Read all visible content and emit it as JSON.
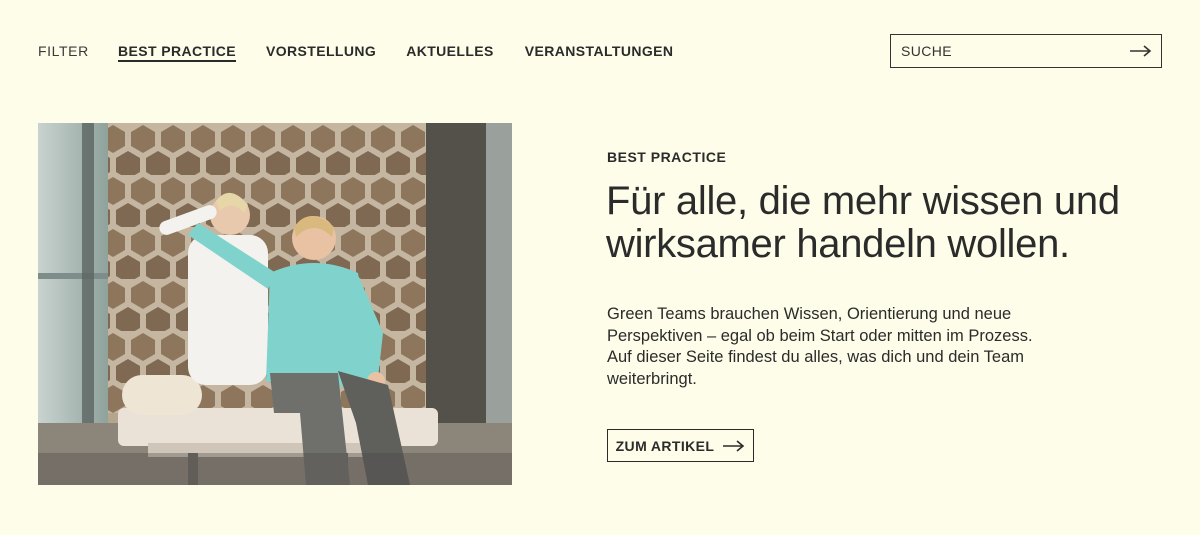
{
  "nav": {
    "filter_label": "FILTER",
    "links": [
      {
        "label": "BEST PRACTICE",
        "active": true
      },
      {
        "label": "VORSTELLUNG"
      },
      {
        "label": "AKTUELLES"
      },
      {
        "label": "VERANSTALTUNGEN"
      }
    ],
    "search": {
      "placeholder": "SUCHE",
      "value": "",
      "icon": "arrow-right-icon"
    }
  },
  "hero": {
    "image_icon": "photo"
  },
  "article": {
    "category": "BEST PRACTICE",
    "headline": "Für alle, die mehr wissen und wirksamer handeln wollen.",
    "body_lines": [
      "Green Teams brauchen Wissen, Orientierung und neue",
      "Perspektiven – egal ob beim Start oder mitten im Prozess.",
      "Auf dieser Seite findest du alles, was dich und dein Team",
      "weiterbringt."
    ],
    "cta_label": "ZUM ARTIKEL",
    "cta_icon": "arrow-right-icon"
  },
  "colors": {
    "background": "#fefde9",
    "text": "#2b2b2b",
    "shirt": "#7fd3cc"
  }
}
